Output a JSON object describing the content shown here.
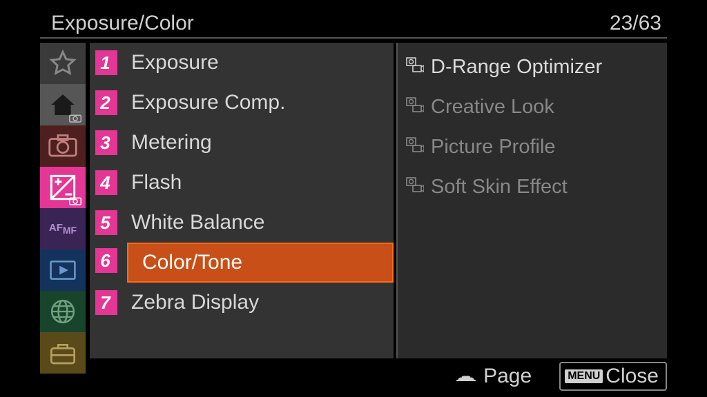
{
  "header": {
    "title": "Exposure/Color",
    "page_current": "23",
    "page_total": "63"
  },
  "sidebar": {
    "tabs": [
      {
        "name": "favorite",
        "color": "#555555"
      },
      {
        "name": "main",
        "color": "#565656"
      },
      {
        "name": "shooting",
        "color": "#6a2a2a"
      },
      {
        "name": "exposure",
        "color": "#e33695"
      },
      {
        "name": "focus",
        "color": "#4a2a7a"
      },
      {
        "name": "playback",
        "color": "#1a3a6e"
      },
      {
        "name": "network",
        "color": "#1a5a3a"
      },
      {
        "name": "setup",
        "color": "#7a6a2a"
      }
    ]
  },
  "menu": {
    "items": [
      {
        "num": "1",
        "label": "Exposure"
      },
      {
        "num": "2",
        "label": "Exposure Comp."
      },
      {
        "num": "3",
        "label": "Metering"
      },
      {
        "num": "4",
        "label": "Flash"
      },
      {
        "num": "5",
        "label": "White Balance"
      },
      {
        "num": "6",
        "label": "Color/Tone"
      },
      {
        "num": "7",
        "label": "Zebra Display"
      }
    ],
    "selected_index": 5
  },
  "submenu": {
    "items": [
      {
        "label": "D-Range Optimizer",
        "highlighted": true
      },
      {
        "label": "Creative Look",
        "highlighted": false
      },
      {
        "label": "Picture Profile",
        "highlighted": false
      },
      {
        "label": "Soft Skin Effect",
        "highlighted": false
      }
    ]
  },
  "footer": {
    "page_label": "Page",
    "close_label": "Close",
    "menu_tag": "MENU"
  }
}
